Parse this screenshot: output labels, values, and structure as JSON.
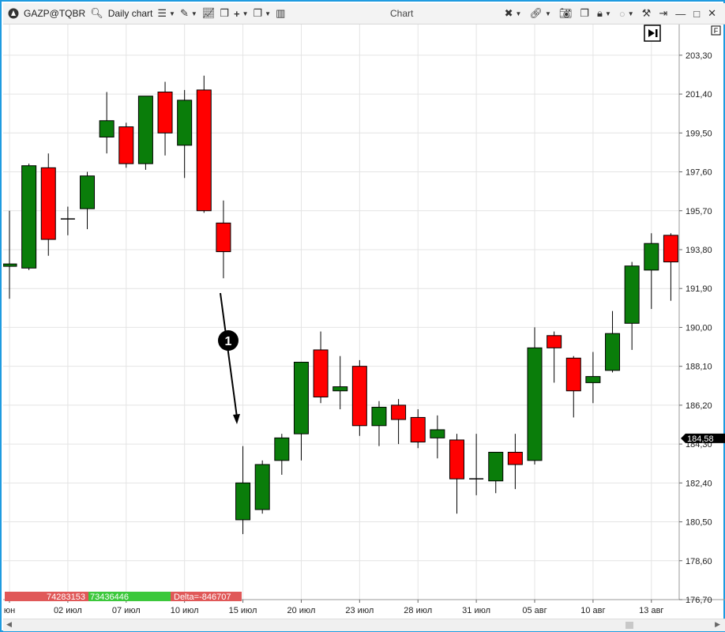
{
  "toolbar": {
    "symbol": "GAZP@TQBR",
    "timeframe": "Daily chart",
    "window_title": "Chart"
  },
  "chart_data": {
    "type": "candlestick",
    "ylim": [
      176.7,
      204.8
    ],
    "y_ticks": [
      "203,30",
      "201,40",
      "199,50",
      "197,60",
      "195,70",
      "193,80",
      "191,90",
      "190,00",
      "188,10",
      "186,20",
      "184,30",
      "182,40",
      "180,50",
      "178,60",
      "176,70"
    ],
    "x_tick_labels": [
      "юн",
      "02 июл",
      "07 июл",
      "10 июл",
      "15 июл",
      "20 июл",
      "23 июл",
      "28 июл",
      "31 июл",
      "05 авг",
      "10 авг",
      "13 авг"
    ],
    "x_tick_index": [
      0,
      3,
      6,
      9,
      12,
      15,
      18,
      21,
      24,
      27,
      30,
      33
    ],
    "current_price": "184,58",
    "candles": [
      {
        "o": 193.0,
        "h": 195.7,
        "l": 191.4,
        "c": 193.1
      },
      {
        "o": 192.9,
        "h": 198.0,
        "l": 192.8,
        "c": 197.9
      },
      {
        "o": 197.8,
        "h": 198.5,
        "l": 193.5,
        "c": 194.3
      },
      {
        "o": 195.3,
        "h": 195.9,
        "l": 194.5,
        "c": 195.3
      },
      {
        "o": 195.8,
        "h": 197.6,
        "l": 194.8,
        "c": 197.4
      },
      {
        "o": 199.3,
        "h": 201.5,
        "l": 198.5,
        "c": 200.1
      },
      {
        "o": 199.8,
        "h": 200.0,
        "l": 197.8,
        "c": 198.0
      },
      {
        "o": 198.0,
        "h": 201.3,
        "l": 197.7,
        "c": 201.3
      },
      {
        "o": 201.5,
        "h": 202.0,
        "l": 198.4,
        "c": 199.5
      },
      {
        "o": 198.9,
        "h": 201.6,
        "l": 197.3,
        "c": 201.1
      },
      {
        "o": 201.6,
        "h": 202.3,
        "l": 195.6,
        "c": 195.7
      },
      {
        "o": 195.1,
        "h": 196.2,
        "l": 192.4,
        "c": 193.7
      },
      {
        "o": 180.6,
        "h": 184.2,
        "l": 179.9,
        "c": 182.4
      },
      {
        "o": 181.1,
        "h": 183.5,
        "l": 180.9,
        "c": 183.3
      },
      {
        "o": 183.5,
        "h": 184.8,
        "l": 182.8,
        "c": 184.6
      },
      {
        "o": 184.8,
        "h": 188.3,
        "l": 183.5,
        "c": 188.3
      },
      {
        "o": 188.9,
        "h": 189.8,
        "l": 186.3,
        "c": 186.6
      },
      {
        "o": 186.9,
        "h": 188.6,
        "l": 186.0,
        "c": 187.1
      },
      {
        "o": 188.1,
        "h": 188.4,
        "l": 184.7,
        "c": 185.2
      },
      {
        "o": 185.2,
        "h": 186.4,
        "l": 184.2,
        "c": 186.1
      },
      {
        "o": 186.2,
        "h": 186.5,
        "l": 184.3,
        "c": 185.5
      },
      {
        "o": 185.6,
        "h": 186.0,
        "l": 184.1,
        "c": 184.4
      },
      {
        "o": 184.6,
        "h": 185.7,
        "l": 183.6,
        "c": 185.0
      },
      {
        "o": 184.5,
        "h": 184.8,
        "l": 180.9,
        "c": 182.6
      },
      {
        "o": 182.6,
        "h": 184.8,
        "l": 181.8,
        "c": 182.6
      },
      {
        "o": 182.5,
        "h": 183.9,
        "l": 181.9,
        "c": 183.9
      },
      {
        "o": 183.9,
        "h": 184.8,
        "l": 182.1,
        "c": 183.3
      },
      {
        "o": 183.5,
        "h": 190.0,
        "l": 183.3,
        "c": 189.0
      },
      {
        "o": 189.6,
        "h": 189.8,
        "l": 187.3,
        "c": 189.0
      },
      {
        "o": 188.5,
        "h": 188.6,
        "l": 185.6,
        "c": 186.9
      },
      {
        "o": 187.3,
        "h": 188.8,
        "l": 186.3,
        "c": 187.6
      },
      {
        "o": 187.9,
        "h": 190.8,
        "l": 187.8,
        "c": 189.7
      },
      {
        "o": 190.2,
        "h": 193.2,
        "l": 188.9,
        "c": 193.0
      },
      {
        "o": 192.8,
        "h": 194.6,
        "l": 190.9,
        "c": 194.1
      },
      {
        "o": 194.5,
        "h": 194.6,
        "l": 191.3,
        "c": 193.2
      }
    ],
    "annotation": {
      "label": "1"
    },
    "delta_bar": {
      "left": "74283153",
      "mid": "73436446",
      "right": "Delta=-846707"
    },
    "colors": {
      "up": "#0a7d0a",
      "down": "#ff0000",
      "wick": "#000000",
      "grid": "#e4e4e4",
      "delta_left": "#e05858",
      "delta_mid": "#3cc83c"
    }
  }
}
